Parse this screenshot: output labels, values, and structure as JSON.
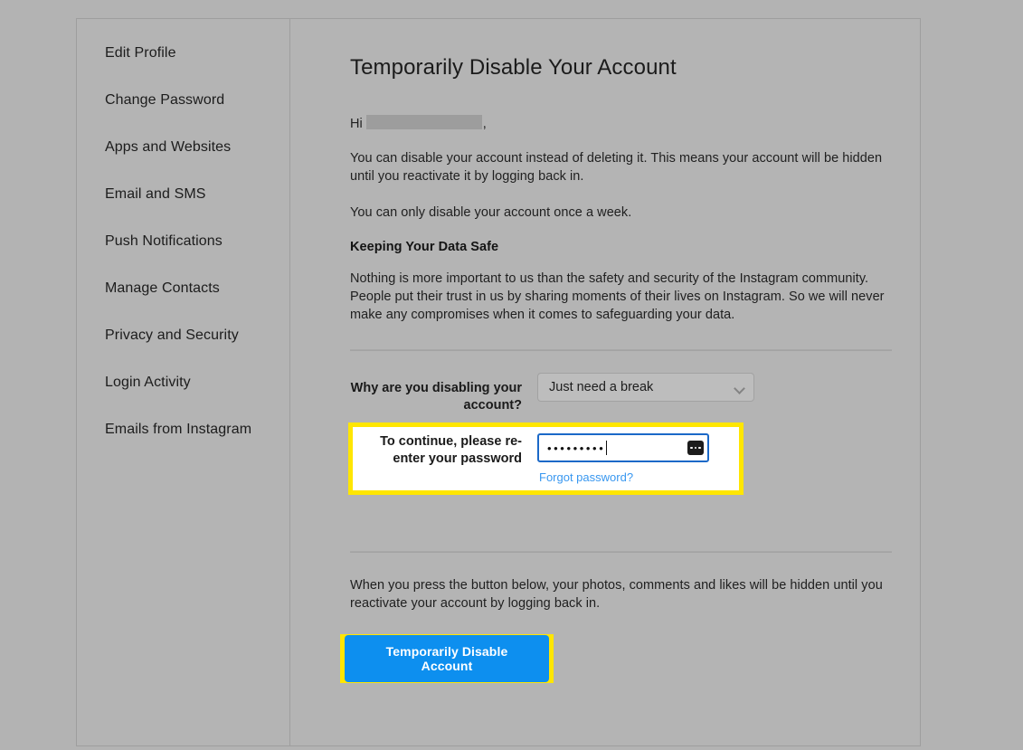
{
  "sidebar": {
    "items": [
      {
        "label": "Edit Profile",
        "name": "edit-profile"
      },
      {
        "label": "Change Password",
        "name": "change-password"
      },
      {
        "label": "Apps and Websites",
        "name": "apps-and-websites"
      },
      {
        "label": "Email and SMS",
        "name": "email-and-sms"
      },
      {
        "label": "Push Notifications",
        "name": "push-notifications"
      },
      {
        "label": "Manage Contacts",
        "name": "manage-contacts"
      },
      {
        "label": "Privacy and Security",
        "name": "privacy-and-security"
      },
      {
        "label": "Login Activity",
        "name": "login-activity"
      },
      {
        "label": "Emails from Instagram",
        "name": "emails-from-instagram"
      }
    ]
  },
  "main": {
    "title": "Temporarily Disable Your Account",
    "greeting_prefix": "Hi",
    "greeting_suffix": ",",
    "intro_paragraph": "You can disable your account instead of deleting it. This means your account will be hidden until you reactivate it by logging back in.",
    "frequency_note": "You can only disable your account once a week.",
    "data_safe_heading": "Keeping Your Data Safe",
    "data_safe_paragraph": "Nothing is more important to us than the safety and security of the Instagram community. People put their trust in us by sharing moments of their lives on Instagram. So we will never make any compromises when it comes to safeguarding your data.",
    "closing_paragraph": "When you press the button below, your photos, comments and likes will be hidden until you reactivate your account by logging back in."
  },
  "form": {
    "reason_label": "Why are you disabling your account?",
    "reason_value": "Just need a break",
    "password_label": "To continue, please re-enter your password",
    "password_value": "•••••••••",
    "password_placeholder": "Password",
    "forgot_password_label": "Forgot password?"
  },
  "actions": {
    "disable_button_label": "Temporarily Disable Account"
  },
  "colors": {
    "page_background": "#b3b3b3",
    "card_background": "#b4b4b4",
    "accent_blue": "#0d8fef",
    "link_blue": "#3897f0",
    "highlight_yellow": "#ffe600",
    "focus_border_blue": "#1b69c8"
  }
}
